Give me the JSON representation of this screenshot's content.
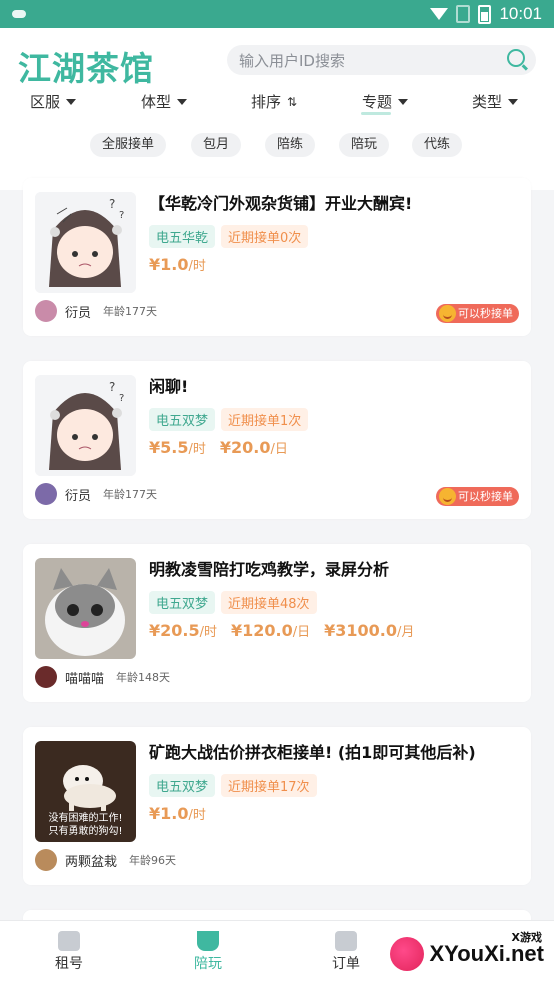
{
  "status_bar": {
    "time": "10:01"
  },
  "header": {
    "brand": "江湖茶馆",
    "search_placeholder": "输入用户ID搜索"
  },
  "filters": [
    {
      "label": "区服"
    },
    {
      "label": "体型"
    },
    {
      "label": "排序"
    },
    {
      "label": "专题"
    },
    {
      "label": "类型"
    }
  ],
  "chips": [
    "全服接单",
    "包月",
    "陪练",
    "陪玩",
    "代练"
  ],
  "cards": [
    {
      "title": "【华乾冷门外观杂货铺】开业大酬宾!",
      "game_tag": "电五华乾",
      "orders_tag": "近期接单0次",
      "prices": [
        {
          "amount": "¥1.0",
          "unit": "/时"
        }
      ],
      "seller_name": "衍员",
      "seller_age": "年龄177天",
      "badge": "可以秒接单",
      "cover_color": "#e9ecef"
    },
    {
      "title": "闲聊!",
      "game_tag": "电五双梦",
      "orders_tag": "近期接单1次",
      "prices": [
        {
          "amount": "¥5.5",
          "unit": "/时"
        },
        {
          "amount": "¥20.0",
          "unit": "/日"
        }
      ],
      "seller_name": "衍员",
      "seller_age": "年龄177天",
      "badge": "可以秒接单",
      "cover_color": "#e9ecef"
    },
    {
      "title": "明教凌雪陪打吃鸡教学，录屏分析",
      "game_tag": "电五双梦",
      "orders_tag": "近期接单48次",
      "prices": [
        {
          "amount": "¥20.5",
          "unit": "/时"
        },
        {
          "amount": "¥120.0",
          "unit": "/日"
        },
        {
          "amount": "¥3100.0",
          "unit": "/月"
        }
      ],
      "seller_name": "喵喵喵",
      "seller_age": "年龄148天",
      "badge": "",
      "cover_color": "#b9b3aa"
    },
    {
      "title": "矿跑大战估价拼衣柜接单! (拍1即可其他后补)",
      "game_tag": "电五双梦",
      "orders_tag": "近期接单17次",
      "prices": [
        {
          "amount": "¥1.0",
          "unit": "/时"
        }
      ],
      "seller_name": "两颗盆栽",
      "seller_age": "年龄96天",
      "badge": "",
      "cover_caption": "没有困难的工作!\n只有勇敢的狗勾!",
      "cover_color": "#3b2a20"
    }
  ],
  "tabbar": [
    {
      "label": "租号",
      "active": false
    },
    {
      "label": "陪玩",
      "active": true
    },
    {
      "label": "订单",
      "active": false
    }
  ],
  "watermark": {
    "text": "XYouXi.net",
    "small": "X游戏"
  }
}
